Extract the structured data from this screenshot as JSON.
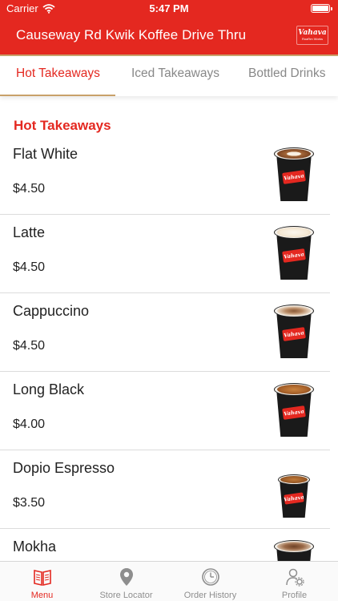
{
  "statusbar": {
    "carrier": "Carrier",
    "time": "5:47 PM"
  },
  "header": {
    "title": "Causeway Rd Kwik Koffee Drive Thru",
    "logo_text": "Vahava",
    "logo_subtext": "Roaf'tm Works"
  },
  "tabs": [
    {
      "label": "Hot Takeaways",
      "active": true
    },
    {
      "label": "Iced Takeaways",
      "active": false
    },
    {
      "label": "Bottled Drinks",
      "active": false
    }
  ],
  "section_title": "Hot Takeaways",
  "cup_label": "Vahava",
  "menu": [
    {
      "name": "Flat White",
      "price": "$4.50"
    },
    {
      "name": "Latte",
      "price": "$4.50"
    },
    {
      "name": "Cappuccino",
      "price": "$4.50"
    },
    {
      "name": "Long Black",
      "price": "$4.00"
    },
    {
      "name": "Dopio Espresso",
      "price": "$3.50"
    },
    {
      "name": "Mokha",
      "price": ""
    }
  ],
  "bottom_nav": [
    {
      "label": "Menu",
      "icon": "menu-book-icon",
      "active": true
    },
    {
      "label": "Store Locator",
      "icon": "location-pin-icon",
      "active": false
    },
    {
      "label": "Order History",
      "icon": "clock-icon",
      "active": false
    },
    {
      "label": "Profile",
      "icon": "profile-settings-icon",
      "active": false
    }
  ],
  "colors": {
    "primary": "#e42820",
    "accent": "#c8a16a",
    "inactive": "#8e8e8e"
  }
}
